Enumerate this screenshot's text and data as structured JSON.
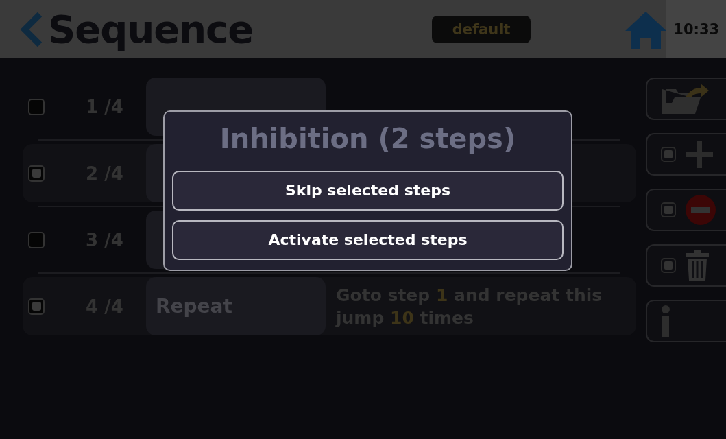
{
  "header": {
    "title": "Sequence",
    "badge": "default",
    "time": "10:33"
  },
  "steps": [
    {
      "checked": false,
      "number": "1 /4"
    },
    {
      "checked": true,
      "number": "2 /4"
    },
    {
      "checked": false,
      "number": "3 /4"
    },
    {
      "checked": true,
      "number": "4 /4",
      "name": "Repeat",
      "description": "Goto step **1** and repeat this jump **10** times"
    }
  ],
  "tools": [
    {
      "kind": "folder"
    },
    {
      "kind": "add",
      "checked": true
    },
    {
      "kind": "remove",
      "checked": true
    },
    {
      "kind": "delete",
      "checked": true
    },
    {
      "kind": "info"
    }
  ],
  "dialog": {
    "title": "Inhibition (2 steps)",
    "buttons": [
      "Skip selected steps",
      "Activate selected steps"
    ]
  }
}
